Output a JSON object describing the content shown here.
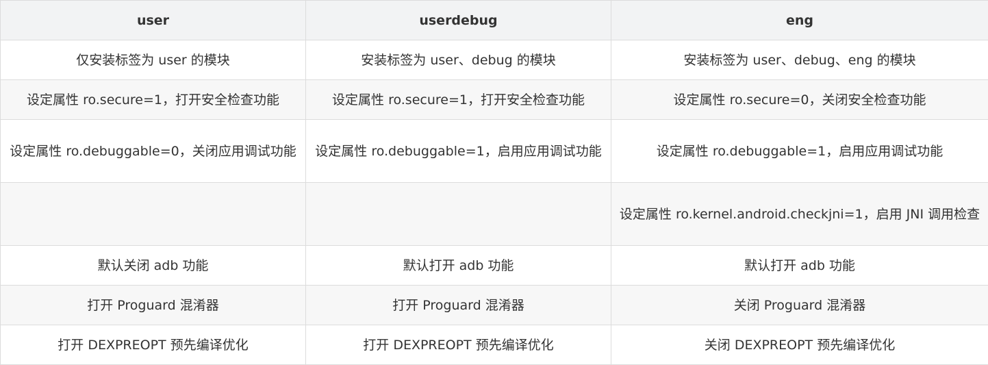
{
  "table": {
    "headers": [
      "user",
      "userdebug",
      "eng"
    ],
    "rows": [
      [
        "仅安装标签为 user 的模块",
        "安装标签为 user、debug 的模块",
        "安装标签为 user、debug、eng 的模块"
      ],
      [
        "设定属性 ro.secure=1，打开安全检查功能",
        "设定属性 ro.secure=1，打开安全检查功能",
        "设定属性 ro.secure=0，关闭安全检查功能"
      ],
      [
        "设定属性 ro.debuggable=0，关闭应用调试功能",
        "设定属性 ro.debuggable=1，启用应用调试功能",
        "设定属性 ro.debuggable=1，启用应用调试功能"
      ],
      [
        "",
        "",
        "设定属性 ro.kernel.android.checkjni=1，启用 JNI 调用检查"
      ],
      [
        "默认关闭 adb 功能",
        "默认打开 adb 功能",
        "默认打开 adb 功能"
      ],
      [
        "打开 Proguard 混淆器",
        "打开 Proguard 混淆器",
        "关闭 Proguard 混淆器"
      ],
      [
        "打开 DEXPREOPT 预先编译优化",
        "打开 DEXPREOPT 预先编译优化",
        "关闭 DEXPREOPT 预先编译优化"
      ]
    ]
  },
  "colors": {
    "header_bg": "#f2f3f4",
    "alt_row_bg": "#f7f7f7",
    "border": "#dcdcdc",
    "text": "#333333"
  }
}
